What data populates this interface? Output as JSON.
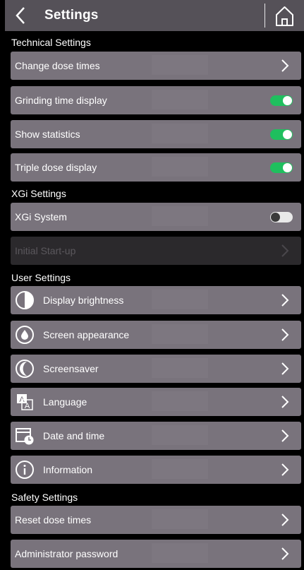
{
  "header": {
    "title": "Settings"
  },
  "sections": {
    "technical": {
      "title": "Technical Settings",
      "items": [
        {
          "label": "Change dose times",
          "control": "chevron"
        },
        {
          "label": "Grinding time display",
          "control": "toggle",
          "value": "on"
        },
        {
          "label": "Show statistics",
          "control": "toggle",
          "value": "on"
        },
        {
          "label": "Triple dose display",
          "control": "toggle",
          "value": "on"
        }
      ]
    },
    "xgi": {
      "title": "XGi Settings",
      "items": [
        {
          "label": "XGi System",
          "control": "toggle",
          "value": "off"
        },
        {
          "label": "Initial Start-up",
          "control": "chevron",
          "disabled": true
        }
      ]
    },
    "user": {
      "title": "User Settings",
      "items": [
        {
          "label": "Display brightness",
          "icon": "brightness-icon"
        },
        {
          "label": "Screen appearance",
          "icon": "water-drop-icon"
        },
        {
          "label": "Screensaver",
          "icon": "moon-icon"
        },
        {
          "label": "Language",
          "icon": "language-icon"
        },
        {
          "label": "Date and time",
          "icon": "calendar-clock-icon"
        },
        {
          "label": "Information",
          "icon": "info-icon"
        }
      ]
    },
    "safety": {
      "title": "Safety Settings",
      "items": [
        {
          "label": "Reset dose times",
          "control": "chevron"
        },
        {
          "label": "Administrator password",
          "control": "chevron"
        }
      ]
    }
  },
  "colors": {
    "row": "#79737c",
    "row_disabled": "#2b292c",
    "toggle_on": "#1fbf5e",
    "toggle_off": "#e9e9e9",
    "header": "#555158"
  }
}
